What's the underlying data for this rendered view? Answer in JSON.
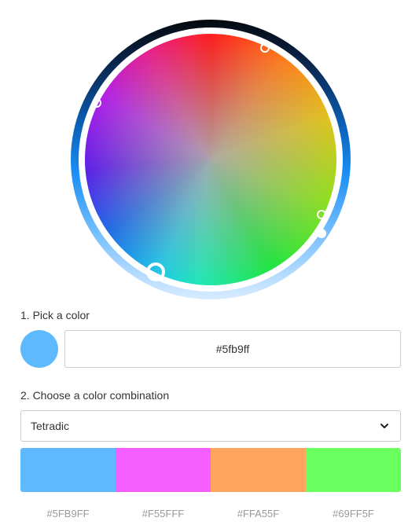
{
  "picker": {
    "step1_label": "1. Pick a color",
    "hex_value": "#5fb9ff",
    "selected_color": "#5fb9ff"
  },
  "combination": {
    "step2_label": "2. Choose a color combination",
    "selected_option": "Tetradic"
  },
  "palette": [
    {
      "color": "#5FB9FF",
      "label": "#5FB9FF"
    },
    {
      "color": "#F55FFF",
      "label": "#F55FFF"
    },
    {
      "color": "#FFA55F",
      "label": "#FFA55F"
    },
    {
      "color": "#69FF5F",
      "label": "#69FF5F"
    }
  ],
  "icons": {
    "select_arrow": "chevron-down-icon"
  }
}
